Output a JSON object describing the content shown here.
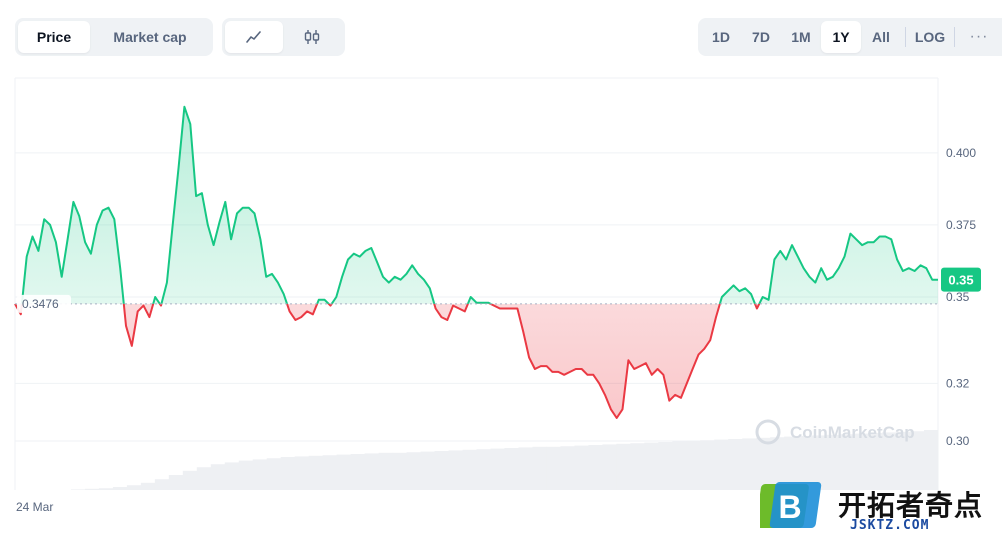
{
  "toolbar": {
    "metric_tabs": [
      {
        "label": "Price",
        "active": true
      },
      {
        "label": "Market cap",
        "active": false
      }
    ],
    "chart_type_tabs": [
      {
        "icon": "line-chart-icon",
        "active": true
      },
      {
        "icon": "candlestick-icon",
        "active": false
      }
    ],
    "range_tabs": [
      {
        "label": "1D",
        "active": false
      },
      {
        "label": "7D",
        "active": false
      },
      {
        "label": "1M",
        "active": false
      },
      {
        "label": "1Y",
        "active": true
      },
      {
        "label": "All",
        "active": false
      }
    ],
    "log_label": "LOG",
    "more_label": "···"
  },
  "watermark": {
    "text": "CoinMarketCap",
    "site_logo_letter": "B",
    "site_name": "开拓者奇点",
    "site_url": "JSKTZ.COM"
  },
  "colors": {
    "up": "#16c784",
    "down": "#ea3943",
    "grid": "#eff2f5",
    "axis_text": "#58667e"
  },
  "chart_data": {
    "type": "area",
    "x_start_label": "24 Mar",
    "baseline": 0.3476,
    "baseline_label": "0.3476",
    "current_price_label": "0.35",
    "y_ticks": [
      0.3,
      0.32,
      0.35,
      0.375,
      0.4
    ],
    "y_tick_labels": [
      "0.30",
      "0.32",
      "0.35",
      "0.375",
      "0.400"
    ],
    "ylim": [
      0.283,
      0.426
    ],
    "grid": true,
    "series": [
      {
        "values": [
          0.3476,
          0.344,
          0.364,
          0.371,
          0.366,
          0.377,
          0.375,
          0.369,
          0.357,
          0.37,
          0.383,
          0.378,
          0.369,
          0.365,
          0.375,
          0.38,
          0.381,
          0.377,
          0.36,
          0.34,
          0.333,
          0.345,
          0.347,
          0.343,
          0.35,
          0.347,
          0.355,
          0.375,
          0.395,
          0.416,
          0.41,
          0.385,
          0.386,
          0.375,
          0.368,
          0.376,
          0.383,
          0.37,
          0.379,
          0.381,
          0.381,
          0.379,
          0.37,
          0.357,
          0.358,
          0.355,
          0.351,
          0.345,
          0.342,
          0.343,
          0.345,
          0.344,
          0.349,
          0.349,
          0.347,
          0.35,
          0.357,
          0.363,
          0.365,
          0.364,
          0.366,
          0.367,
          0.362,
          0.357,
          0.355,
          0.357,
          0.356,
          0.358,
          0.361,
          0.358,
          0.356,
          0.353,
          0.346,
          0.343,
          0.342,
          0.347,
          0.346,
          0.345,
          0.35,
          0.348,
          0.348,
          0.348,
          0.347,
          0.346,
          0.346,
          0.346,
          0.346,
          0.338,
          0.329,
          0.325,
          0.326,
          0.326,
          0.324,
          0.324,
          0.323,
          0.324,
          0.325,
          0.325,
          0.323,
          0.323,
          0.32,
          0.316,
          0.311,
          0.308,
          0.311,
          0.328,
          0.325,
          0.326,
          0.327,
          0.323,
          0.325,
          0.323,
          0.314,
          0.316,
          0.315,
          0.32,
          0.325,
          0.33,
          0.332,
          0.335,
          0.343,
          0.35,
          0.352,
          0.354,
          0.352,
          0.353,
          0.351,
          0.346,
          0.35,
          0.349,
          0.363,
          0.366,
          0.363,
          0.368,
          0.364,
          0.36,
          0.357,
          0.355,
          0.36,
          0.356,
          0.357,
          0.36,
          0.364,
          0.372,
          0.37,
          0.368,
          0.369,
          0.369,
          0.371,
          0.371,
          0.37,
          0.363,
          0.359,
          0.36,
          0.359,
          0.361,
          0.36,
          0.356,
          0.356
        ]
      }
    ],
    "volume": {
      "description_none": "",
      "values": [
        0.0,
        0.0,
        0.0,
        0.0,
        0.01,
        0.02,
        0.03,
        0.05,
        0.08,
        0.12,
        0.18,
        0.25,
        0.32,
        0.38,
        0.43,
        0.46,
        0.49,
        0.51,
        0.53,
        0.55,
        0.56,
        0.57,
        0.58,
        0.59,
        0.6,
        0.61,
        0.62,
        0.62,
        0.63,
        0.64,
        0.65,
        0.66,
        0.67,
        0.68,
        0.69,
        0.7,
        0.71,
        0.72,
        0.72,
        0.73,
        0.74,
        0.75,
        0.76,
        0.77,
        0.78,
        0.79,
        0.8,
        0.81,
        0.82,
        0.83,
        0.84,
        0.85,
        0.86,
        0.87,
        0.88,
        0.89,
        0.9,
        0.91,
        0.92,
        0.93,
        0.94,
        0.95,
        0.96,
        0.97,
        0.98,
        1.0
      ]
    }
  }
}
